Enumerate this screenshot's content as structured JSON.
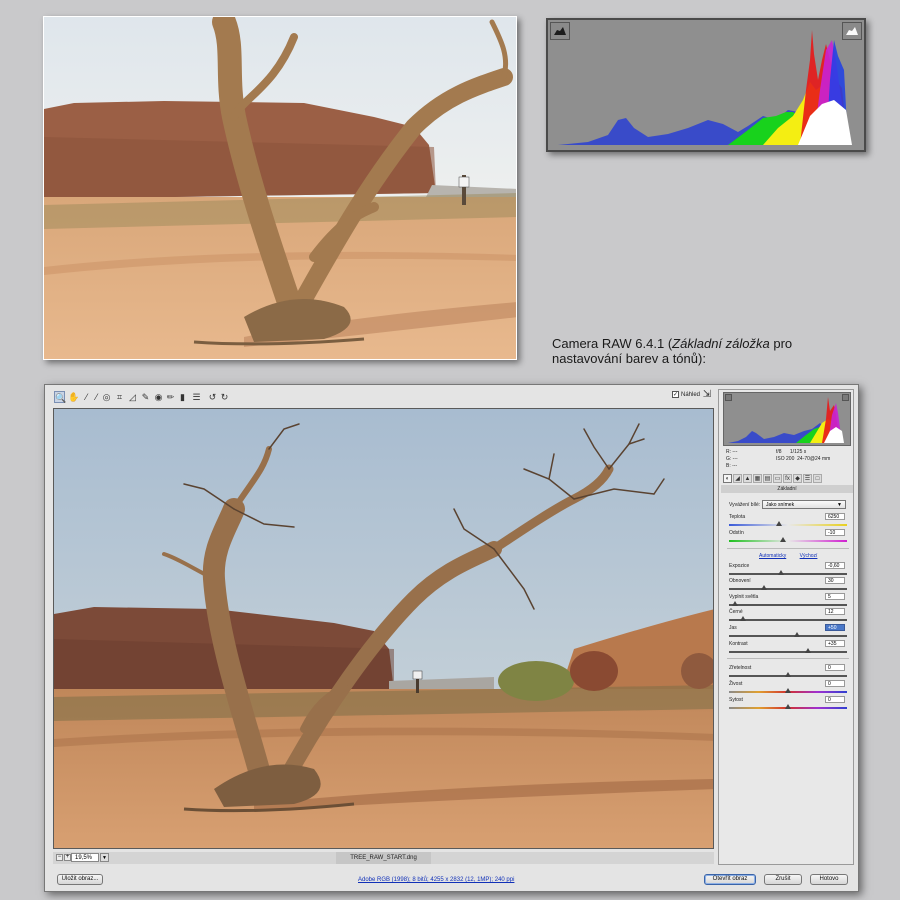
{
  "caption": {
    "prefix": "Camera RAW 6.4.1 (",
    "emph": "Základní záložka",
    "suffix": " pro nastavování barev a tónů):"
  },
  "toolbar": {
    "tools": [
      {
        "icon": "zoom-icon",
        "glyph": "🔍"
      },
      {
        "icon": "hand-icon",
        "glyph": "✋"
      },
      {
        "icon": "white-balance-icon",
        "glyph": "⁄"
      },
      {
        "icon": "color-sampler-icon",
        "glyph": "⁄"
      },
      {
        "icon": "target-adjust-icon",
        "glyph": "◎"
      },
      {
        "icon": "crop-icon",
        "glyph": "⌗"
      },
      {
        "icon": "straighten-icon",
        "glyph": "◿"
      },
      {
        "icon": "spot-removal-icon",
        "glyph": "✎"
      },
      {
        "icon": "red-eye-icon",
        "glyph": "◉"
      },
      {
        "icon": "adjustment-brush-icon",
        "glyph": "✏"
      },
      {
        "icon": "graduated-filter-icon",
        "glyph": "▮"
      },
      {
        "icon": "preferences-icon",
        "glyph": "☰"
      },
      {
        "icon": "rotate-left-icon",
        "glyph": "↺"
      },
      {
        "icon": "rotate-right-icon",
        "glyph": "↻"
      }
    ],
    "preview_label": "Náhled",
    "preview_checked": "✓"
  },
  "status": {
    "zoom": "19,5%",
    "filename": "TREE_RAW_START.dng"
  },
  "bottom": {
    "save_label": "Uložit obraz...",
    "workflow_link": "Adobe RGB (1998); 8 bitů; 4255 x 2832 (12, 1MP); 240 ppi",
    "open_label": "Otevřít obraz",
    "cancel_label": "Zrušit",
    "done_label": "Hotovo"
  },
  "panel": {
    "rgb": {
      "r": "R:   ---",
      "g": "G:   ---",
      "b": "B:   ---"
    },
    "exif": {
      "aperture": "f/8",
      "shutter": "1/125 s",
      "iso": "ISO 200",
      "lens": "24-70@24 mm"
    },
    "tab_icons": [
      "basic-icon",
      "tone-curve-icon",
      "detail-icon",
      "hsl-icon",
      "split-toning-icon",
      "lens-icon",
      "fx-icon",
      "camera-calibration-icon",
      "presets-icon",
      "snapshots-icon"
    ],
    "section_title": "Základní",
    "wb_label": "Vyvážení bílé:",
    "wb_value": "Jako snímek",
    "links": {
      "auto": "Automaticky",
      "default": "Výchozí"
    },
    "sliders": [
      {
        "label": "Teplota",
        "value": "6250",
        "pos": 0.42
      },
      {
        "label": "Odstín",
        "value": "-10",
        "pos": 0.46
      },
      {
        "label": "Expozice",
        "value": "-0,60",
        "pos": 0.44
      },
      {
        "label": "Obnovení",
        "value": "30",
        "pos": 0.3
      },
      {
        "label": "Vyplnit světla",
        "value": "5",
        "pos": 0.05
      },
      {
        "label": "Černé",
        "value": "12",
        "pos": 0.12
      },
      {
        "label": "Jas",
        "value": "+50",
        "pos": 0.58
      },
      {
        "label": "Kontrast",
        "value": "+35",
        "pos": 0.67
      },
      {
        "label": "Zřetelnost",
        "value": "0",
        "pos": 0.5
      },
      {
        "label": "Živost",
        "value": "0",
        "pos": 0.5
      },
      {
        "label": "Sytost",
        "value": "0",
        "pos": 0.5
      }
    ]
  },
  "colors": {
    "accent": "#3a64a8",
    "link": "#1030b8"
  }
}
